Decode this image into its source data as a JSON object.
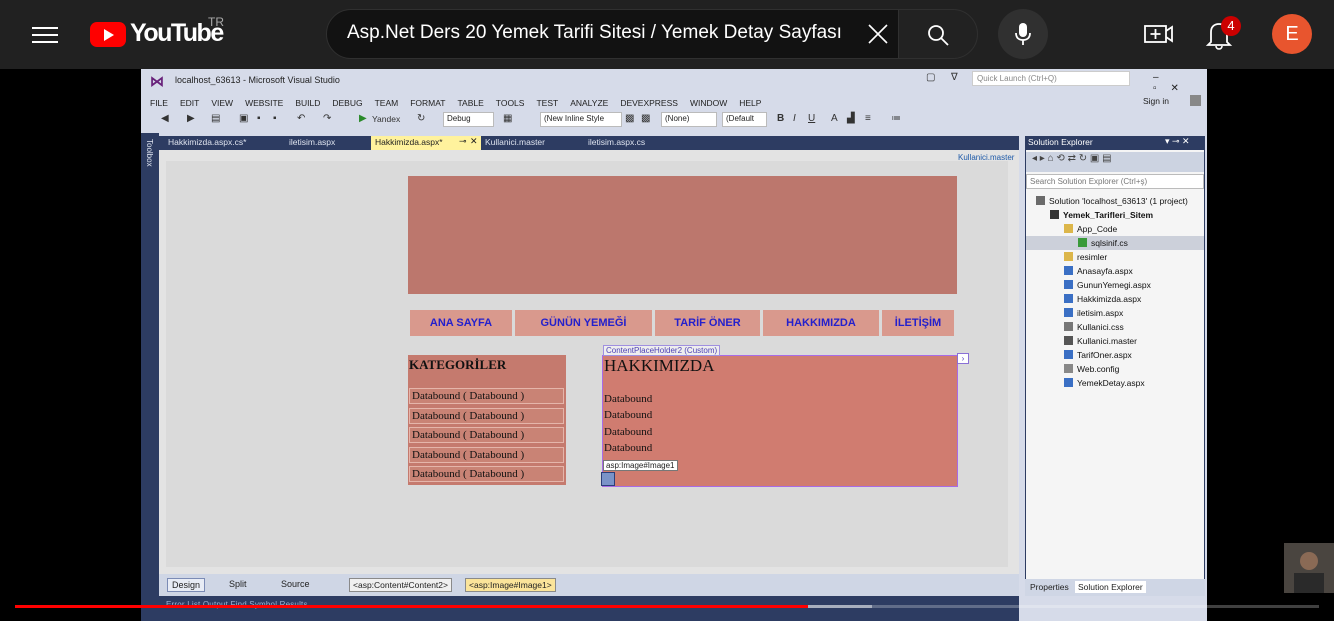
{
  "youtube": {
    "logo_text": "YouTube",
    "country_code": "TR",
    "search_query": "Asp.Net Ders 20 Yemek Tarifi Sitesi / Yemek Detay Sayfası",
    "notification_count": "4",
    "avatar_letter": "E",
    "colors": {
      "brand": "#ff0000",
      "bg": "#212121",
      "avatar": "#e8552e"
    }
  },
  "vs": {
    "title": "localhost_63613 - Microsoft Visual Studio",
    "quick_launch_placeholder": "Quick Launch (Ctrl+Q)",
    "sign_in": "Sign in",
    "menu": [
      "FILE",
      "EDIT",
      "VIEW",
      "WEBSITE",
      "BUILD",
      "DEBUG",
      "TEAM",
      "FORMAT",
      "TABLE",
      "TOOLS",
      "TEST",
      "ANALYZE",
      "DEVEXPRESS",
      "WINDOW",
      "HELP"
    ],
    "toolbar": {
      "browser": "Yandex",
      "config": "Debug",
      "style": "(New Inline Style",
      "font": "(None)",
      "size": "(Default"
    },
    "doc_tabs": [
      "Hakkimizda.aspx.cs*",
      "iletisim.aspx",
      "Hakkimizda.aspx*",
      "Kullanici.master",
      "iletisim.aspx.cs"
    ],
    "toolbox_label": "Toolbox",
    "master_label": "Kullanici.master",
    "designer": {
      "nav": [
        "ANA SAYFA",
        "GÜNÜN YEMEĞİ",
        "TARİF ÖNER",
        "HAKKIMIZDA",
        "İLETİŞİM"
      ],
      "categories_title": "KATEGORİLER",
      "categories": [
        "Databound  ( Databound )",
        "Databound  ( Databound )",
        "Databound  ( Databound )",
        "Databound  ( Databound )",
        "Databound  ( Databound )"
      ],
      "placeholder_tag": "ContentPlaceHolder2 (Custom)",
      "about_title": "HAKKIMIZDA",
      "about_lines": [
        "Databound",
        "Databound",
        "Databound",
        "Databound"
      ],
      "image_tag": "asp:Image#Image1"
    },
    "views": [
      "Design",
      "Split",
      "Source"
    ],
    "breadcrumbs": [
      "<asp:Content#Content2>",
      "<asp:Image#Image1>"
    ],
    "bottom_tabs": "Error List   Output   Find Symbol Results",
    "solution_explorer": {
      "title": "Solution Explorer",
      "search_placeholder": "Search Solution Explorer (Ctrl+ş)",
      "tree": [
        {
          "label": "Solution 'localhost_63613' (1 project)",
          "indent": 0,
          "icon": "solution-icon"
        },
        {
          "label": "Yemek_Tarifleri_Sitem",
          "indent": 1,
          "icon": "website-icon",
          "bold": true
        },
        {
          "label": "App_Code",
          "indent": 2,
          "icon": "folder-icon"
        },
        {
          "label": "sqlsinif.cs",
          "indent": 3,
          "icon": "csharp-file-icon",
          "selected": true
        },
        {
          "label": "resimler",
          "indent": 2,
          "icon": "folder-icon"
        },
        {
          "label": "Anasayfa.aspx",
          "indent": 2,
          "icon": "aspx-file-icon"
        },
        {
          "label": "GununYemegi.aspx",
          "indent": 2,
          "icon": "aspx-file-icon"
        },
        {
          "label": "Hakkimizda.aspx",
          "indent": 2,
          "icon": "aspx-file-icon"
        },
        {
          "label": "iletisim.aspx",
          "indent": 2,
          "icon": "aspx-file-icon"
        },
        {
          "label": "Kullanici.css",
          "indent": 2,
          "icon": "css-file-icon"
        },
        {
          "label": "Kullanici.master",
          "indent": 2,
          "icon": "master-file-icon"
        },
        {
          "label": "TarifOner.aspx",
          "indent": 2,
          "icon": "aspx-file-icon"
        },
        {
          "label": "Web.config",
          "indent": 2,
          "icon": "config-file-icon"
        },
        {
          "label": "YemekDetay.aspx",
          "indent": 2,
          "icon": "aspx-file-icon"
        }
      ],
      "bottom_tabs": [
        "Properties",
        "Solution Explorer"
      ]
    }
  },
  "player": {
    "progress_played": 0.608,
    "progress_buffered": 0.657
  }
}
